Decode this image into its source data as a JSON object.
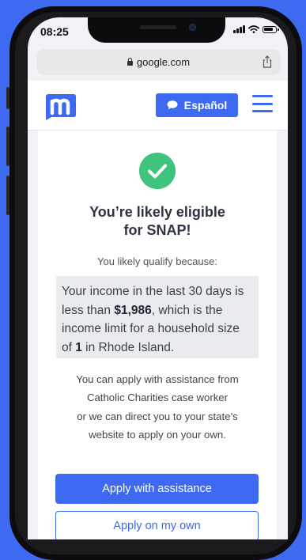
{
  "status": {
    "time": "08:25"
  },
  "browser": {
    "url": "google.com"
  },
  "header": {
    "language_button": "Español"
  },
  "result": {
    "title_line1": "You’re likely eligible",
    "title_line2": "for SNAP!",
    "reason_label": "You likely qualify because:",
    "reason": {
      "part1": "Your income in the last 30 days is less than ",
      "amount": "$1,986",
      "part2": ", which is the income limit for a household size of ",
      "household_size": "1",
      "part3": " in Rhode Island."
    },
    "apply_info": {
      "line1": "You can apply with assistance from",
      "line2": "Catholic Charities case worker",
      "line3": "or we can direct you to your state’s",
      "line4": "website to apply on your own."
    },
    "primary_button": "Apply with assistance",
    "secondary_button": "Apply on my own"
  },
  "colors": {
    "accent": "#3d6af0",
    "success": "#3ec47c",
    "background": "#3d6af0"
  }
}
